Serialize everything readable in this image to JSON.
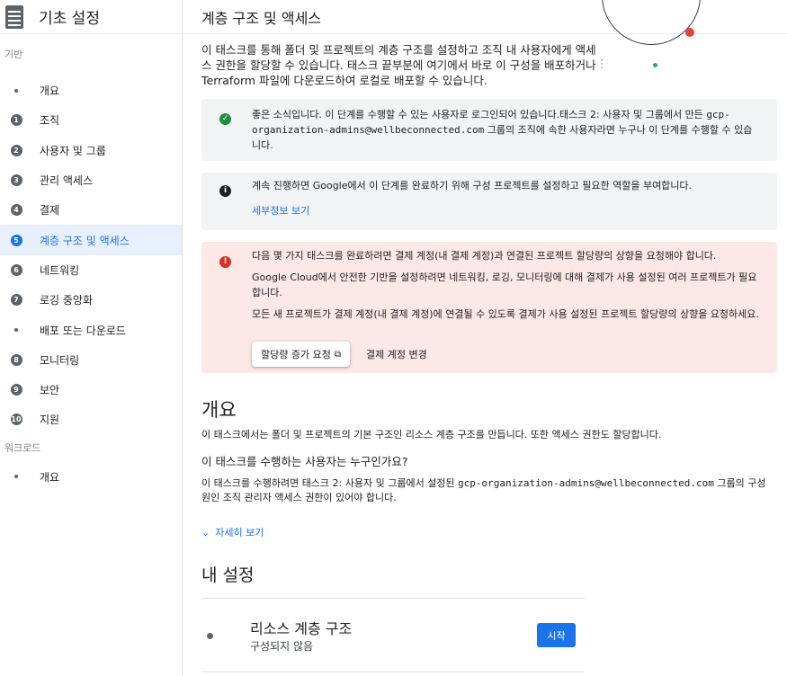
{
  "sidebar": {
    "title": "기초 설정",
    "section_base": "기반",
    "items": [
      {
        "marker": "",
        "label": "개요"
      },
      {
        "marker": "1",
        "label": "조직"
      },
      {
        "marker": "2",
        "label": "사용자 및 그룹"
      },
      {
        "marker": "3",
        "label": "관리 액세스"
      },
      {
        "marker": "4",
        "label": "결제"
      },
      {
        "marker": "5",
        "label": "계층 구조 및 액세스"
      },
      {
        "marker": "6",
        "label": "네트워킹"
      },
      {
        "marker": "7",
        "label": "로깅 중앙화"
      },
      {
        "marker": "",
        "label": "배포 또는 다운로드"
      },
      {
        "marker": "8",
        "label": "모니터링"
      },
      {
        "marker": "9",
        "label": "보안"
      },
      {
        "marker": "10",
        "label": "지원"
      }
    ],
    "section_workload": "워크로드",
    "workload_items": [
      {
        "marker": "",
        "label": "개요"
      }
    ],
    "active_index": 5
  },
  "header": {
    "title": "계층 구조 및 액세스"
  },
  "intro": "이 태스크를 통해 폴더 및 프로젝트의 계층 구조를 설정하고 조직 내 사용자에게 액세스 권한을 할당할 수 있습니다. 태스크 끝부분에 여기에서 바로 이 구성을 배포하거나 Terraform 파일에 다운로드하여 로컬로 배포할 수 있습니다.",
  "notice_success": {
    "text_before": "좋은 소식입니다. 이 단계를 수행할 수 있는 사용자로 로그인되어 있습니다.태스크 2: 사용자 및 그룹에서 만든 ",
    "group": "gcp-organization-admins@wellbeconnected.com",
    "text_after": " 그룹의 조직에 속한 사용자라면 누구나 이 단계를 수행할 수 있습니다."
  },
  "notice_info": {
    "text": "계속 진행하면 Google에서 이 단계를 완료하기 위해 구성 프로젝트를 설정하고 필요한 역할을 부여합니다.",
    "link": "세부정보 보기"
  },
  "notice_error": {
    "p1": "다음 몇 가지 태스크를 완료하려면 결제 계정(내 결제 계정)과 연결된 프로젝트 할당량의 상향을 요청해야 합니다.",
    "p2": "Google Cloud에서 안전한 기반을 설정하려면 네트워킹, 로깅, 모니터링에 대해 결제가 사용 설정된 여러 프로젝트가 필요합니다.",
    "p3": "모든 새 프로젝트가 결제 계정(내 결제 계정)에 연결될 수 있도록 결제가 사용 설정된 프로젝트 할당량의 상향을 요청하세요.",
    "button_quota": "할당량 증가 요청",
    "button_billing": "결제 계정 변경"
  },
  "overview": {
    "heading": "개요",
    "text": "이 태스크에서는 폴더 및 프로젝트의 기본 구조인 리소스 계층 구조를 만듭니다. 또한 액세스 권한도 할당합니다.",
    "who_heading": "이 태스크를 수행하는 사용자는 누구인가요?",
    "who_before": "이 태스크를 수행하려면 태스크 2: 사용자 및 그룹에서 설정된 ",
    "who_group": "gcp-organization-admins@wellbeconnected.com",
    "who_after": " 그룹의 구성원인 조직 관리자 액세스 권한이 있어야 합니다.",
    "more": "자세히 보기"
  },
  "settings": {
    "heading": "내 설정",
    "item_name": "리소스 계층 구조",
    "item_status": "구성되지 않음",
    "start_button": "시작"
  },
  "colors": {
    "accent": "#1a73e8",
    "success": "#1e8e3e",
    "error": "#d93025",
    "error_bg": "#fce8e6",
    "neutral_bg": "#f1f3f4"
  }
}
